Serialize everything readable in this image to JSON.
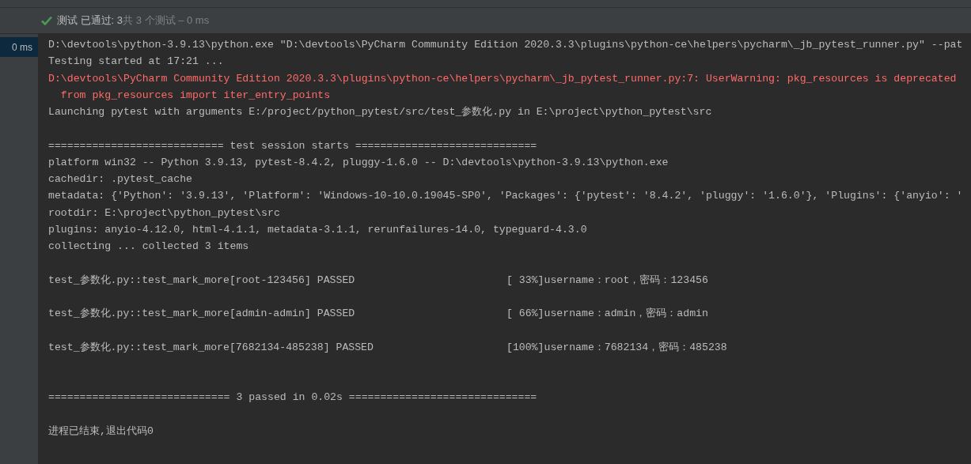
{
  "header": {
    "summary": "测试 已通过: 3",
    "details": "共 3 个测试 – 0 ms"
  },
  "tree": [
    {
      "label": "0 ms",
      "selected": true
    }
  ],
  "console": {
    "lines": [
      {
        "kind": "normal",
        "text": "D:\\devtools\\python-3.9.13\\python.exe \"D:\\devtools\\PyCharm Community Edition 2020.3.3\\plugins\\python-ce\\helpers\\pycharm\\_jb_pytest_runner.py\" --pat"
      },
      {
        "kind": "normal",
        "text": "Testing started at 17:21 ..."
      },
      {
        "kind": "error",
        "text": "D:\\devtools\\PyCharm Community Edition 2020.3.3\\plugins\\python-ce\\helpers\\pycharm\\_jb_pytest_runner.py:7: UserWarning: pkg_resources is deprecated"
      },
      {
        "kind": "error",
        "text": "  from pkg_resources import iter_entry_points"
      },
      {
        "kind": "normal",
        "text": "Launching pytest with arguments E:/project/python_pytest/src/test_参数化.py in E:\\project\\python_pytest\\src"
      },
      {
        "kind": "blank"
      },
      {
        "kind": "normal",
        "text": "============================ test session starts ============================="
      },
      {
        "kind": "normal",
        "text": "platform win32 -- Python 3.9.13, pytest-8.4.2, pluggy-1.6.0 -- D:\\devtools\\python-3.9.13\\python.exe"
      },
      {
        "kind": "normal",
        "text": "cachedir: .pytest_cache"
      },
      {
        "kind": "normal",
        "text": "metadata: {'Python': '3.9.13', 'Platform': 'Windows-10-10.0.19045-SP0', 'Packages': {'pytest': '8.4.2', 'pluggy': '1.6.0'}, 'Plugins': {'anyio': '"
      },
      {
        "kind": "normal",
        "text": "rootdir: E:\\project\\python_pytest\\src"
      },
      {
        "kind": "normal",
        "text": "plugins: anyio-4.12.0, html-4.1.1, metadata-3.1.1, rerunfailures-14.0, typeguard-4.3.0"
      },
      {
        "kind": "normal",
        "text": "collecting ... collected 3 items"
      },
      {
        "kind": "blank"
      },
      {
        "kind": "test_result",
        "name": "test_参数化.py::test_mark_more[root-123456] PASSED",
        "result": "[ 33%]username：root，密码：123456"
      },
      {
        "kind": "blank"
      },
      {
        "kind": "test_result",
        "name": "test_参数化.py::test_mark_more[admin-admin] PASSED",
        "result": "[ 66%]username：admin，密码：admin"
      },
      {
        "kind": "blank"
      },
      {
        "kind": "test_result",
        "name": "test_参数化.py::test_mark_more[7682134-485238] PASSED",
        "result": "[100%]username：7682134，密码：485238"
      },
      {
        "kind": "blank"
      },
      {
        "kind": "blank"
      },
      {
        "kind": "normal",
        "text": "============================= 3 passed in 0.02s =============================="
      },
      {
        "kind": "blank"
      },
      {
        "kind": "normal",
        "text": "进程已结束,退出代码0"
      }
    ]
  }
}
